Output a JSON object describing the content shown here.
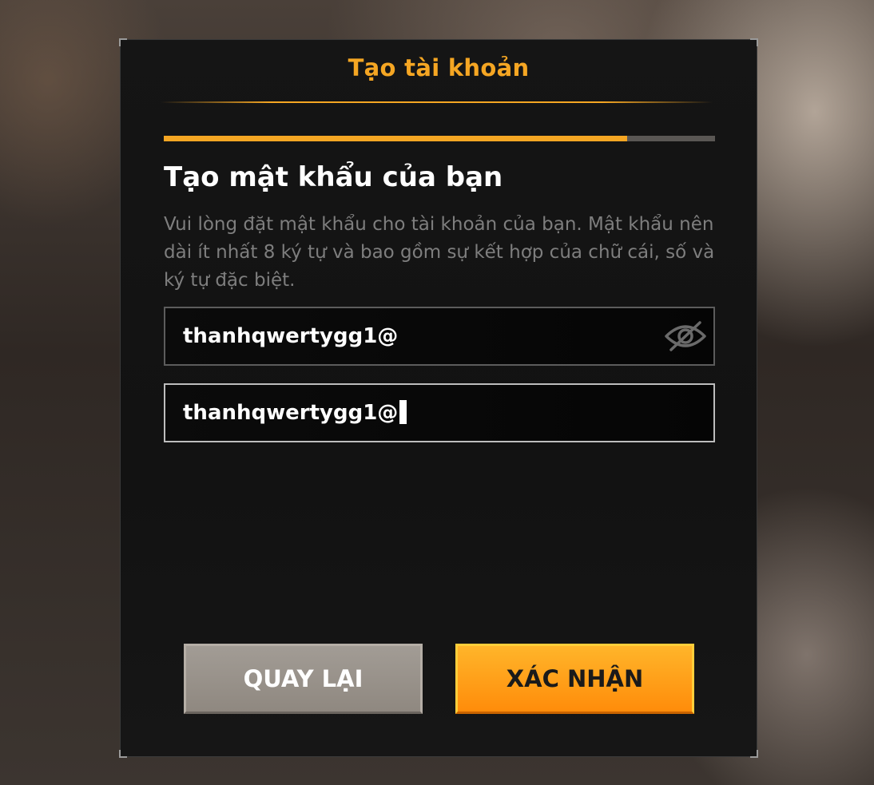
{
  "dialog": {
    "title": "Tạo tài khoản",
    "accent_color": "#f5a623"
  },
  "progress": {
    "fraction": 0.84
  },
  "step": {
    "heading": "Tạo mật khẩu của bạn",
    "description": "Vui lòng đặt mật khẩu cho tài khoản của bạn. Mật khẩu nên dài ít nhất 8 ký tự và bao gồm sự kết hợp của chữ cái, số và ký tự đặc biệt."
  },
  "fields": {
    "password": {
      "value": "thanhqwertygg1@",
      "icon": "eye-slash-icon"
    },
    "confirm_password": {
      "value": "thanhqwertygg1@",
      "focused": true
    }
  },
  "buttons": {
    "back_label": "QUAY LẠI",
    "confirm_label": "XÁC NHẬN",
    "back_color": "#9a938c",
    "confirm_color": "#ff9f1a"
  }
}
